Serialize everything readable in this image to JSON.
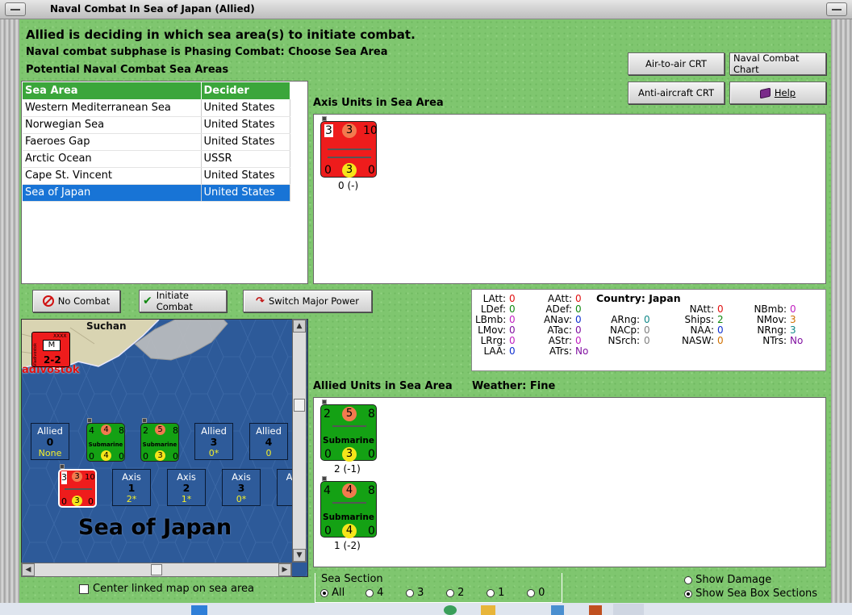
{
  "window": {
    "title": "Naval Combat In Sea of Japan (Allied)"
  },
  "header": {
    "line1": "Allied is deciding in which sea area(s) to initiate combat.",
    "line2": "Naval combat subphase is Phasing Combat: Choose Sea Area",
    "line3": "Potential Naval Combat Sea Areas"
  },
  "buttons": {
    "air_to_air": "Air-to-air CRT",
    "naval_chart": "Naval Combat Chart",
    "anti_aircraft": "Anti-aircraft CRT",
    "help": "Help",
    "no_combat": "No Combat",
    "initiate": "Initiate Combat",
    "switch": "Switch Major Power"
  },
  "sea_table": {
    "headers": [
      "Sea Area",
      "Decider"
    ],
    "rows": [
      [
        "Western Mediterranean Sea",
        "United States"
      ],
      [
        "Norwegian Sea",
        "United States"
      ],
      [
        "Faeroes Gap",
        "United States"
      ],
      [
        "Arctic Ocean",
        "USSR"
      ],
      [
        "Cape St. Vincent",
        "United States"
      ],
      [
        "Sea of Japan",
        "United States"
      ]
    ],
    "selected_index": 5
  },
  "axis_panel": {
    "label": "Axis Units in Sea Area",
    "unit": {
      "tl": "3",
      "tm": "3",
      "tr": "10",
      "bl": "0",
      "bm": "3",
      "br": "0",
      "caption": "0 (-)"
    }
  },
  "allied_panel": {
    "label": "Allied Units in Sea Area",
    "weather_label": "Weather:",
    "weather": "Fine",
    "units": [
      {
        "tl": "2",
        "tm": "5",
        "tr": "8",
        "name": "Submarine",
        "bl": "0",
        "bm": "3",
        "br": "0",
        "caption": "2 (-1)"
      },
      {
        "tl": "4",
        "tm": "4",
        "tr": "8",
        "name": "Submarine",
        "bl": "0",
        "bm": "4",
        "br": "0",
        "caption": "1 (-2)"
      }
    ]
  },
  "stats": {
    "country_label": "Country:",
    "country": "Japan",
    "col1": [
      [
        "LAtt:",
        "0"
      ],
      [
        "LDef:",
        "0"
      ],
      [
        "LBmb:",
        "0"
      ],
      [
        "LMov:",
        "0"
      ],
      [
        "LRrg:",
        "0"
      ],
      [
        "LAA:",
        "0"
      ]
    ],
    "col2": [
      [
        "AAtt:",
        "0"
      ],
      [
        "ADef:",
        "0"
      ],
      [
        "ANav:",
        "0"
      ],
      [
        "ATac:",
        "0"
      ],
      [
        "AStr:",
        "0"
      ],
      [
        "ATrs:",
        "No"
      ]
    ],
    "col3": [
      [
        "ARng:",
        "0"
      ],
      [
        "NACp:",
        "0"
      ],
      [
        "NSrch:",
        "0"
      ]
    ],
    "col4": [
      [
        "NAtt:",
        "0"
      ],
      [
        "Ships:",
        "2"
      ],
      [
        "NAA:",
        "0"
      ],
      [
        "NASW:",
        "0"
      ]
    ],
    "col5": [
      [
        "NBmb:",
        "0"
      ],
      [
        "NMov:",
        "3"
      ],
      [
        "NRng:",
        "3"
      ],
      [
        "NTrs:",
        "No"
      ]
    ],
    "colors": {
      "red": "#e01010",
      "blue": "#1030d0",
      "magenta": "#c020c0",
      "teal": "#108888",
      "orange": "#d07000",
      "green": "#108810",
      "purple": "#8010a0",
      "gray": "#808080"
    }
  },
  "map": {
    "city": "Suchan",
    "city2": "adivostok",
    "hq_letter": "M",
    "hq_top": "XXXX",
    "hq_vert": "Vladivostok",
    "hq_value": "2-2",
    "sea_name": "Sea of Japan",
    "allied_boxes": [
      {
        "label": "Allied",
        "num": "0",
        "sub": "None"
      },
      {
        "label": "Allied",
        "num": "3",
        "sub": "0*"
      },
      {
        "label": "Allied",
        "num": "4",
        "sub": "0"
      }
    ],
    "axis_boxes": [
      {
        "label": "Axis",
        "num": "1",
        "sub": "2*"
      },
      {
        "label": "Axis",
        "num": "2",
        "sub": "1*"
      },
      {
        "label": "Axis",
        "num": "3",
        "sub": "0*"
      },
      {
        "label": "A"
      }
    ],
    "map_units": [
      {
        "tl": "4",
        "tm": "4",
        "tr": "8",
        "name": "Submarine",
        "bl": "0",
        "bm": "4",
        "br": "0"
      },
      {
        "tl": "2",
        "tm": "5",
        "tr": "8",
        "name": "Submarine",
        "bl": "0",
        "bm": "3",
        "br": "0"
      },
      {
        "tl": "3",
        "tm": "3",
        "tr": "10",
        "bl": "0",
        "bm": "3",
        "br": "0"
      }
    ]
  },
  "center_map_label": "Center linked map on sea area",
  "sea_section": {
    "label": "Sea Section",
    "options": [
      "All",
      "4",
      "3",
      "2",
      "1",
      "0"
    ],
    "selected": "All"
  },
  "options": {
    "show_damage": "Show Damage",
    "show_sections": "Show Sea Box Sections"
  }
}
